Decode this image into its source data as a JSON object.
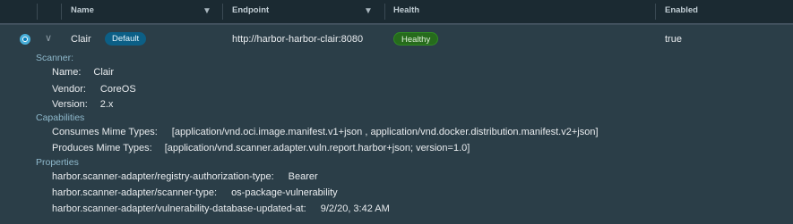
{
  "header": {
    "columns": [
      {
        "label": "Name"
      },
      {
        "label": "Endpoint"
      },
      {
        "label": "Health"
      },
      {
        "label": "Enabled"
      }
    ]
  },
  "row": {
    "name": "Clair",
    "default_badge": "Default",
    "endpoint": "http://harbor-harbor-clair:8080",
    "health": "Healthy",
    "enabled": "true"
  },
  "details": {
    "scanner_heading": "Scanner:",
    "scanner": [
      {
        "label": "Name:",
        "value": "Clair"
      },
      {
        "label": "Vendor:",
        "value": "CoreOS"
      },
      {
        "label": "Version:",
        "value": "2.x"
      }
    ],
    "capabilities_heading": "Capabilities",
    "consumes_label": "Consumes Mime Types:",
    "consumes_value": "[application/vnd.oci.image.manifest.v1+json , application/vnd.docker.distribution.manifest.v2+json]",
    "produces_label": "Produces Mime Types:",
    "produces_value": "[application/vnd.scanner.adapter.vuln.report.harbor+json; version=1.0]",
    "properties_heading": "Properties",
    "properties": [
      {
        "key": "harbor.scanner-adapter/registry-authorization-type:",
        "value": "Bearer"
      },
      {
        "key": "harbor.scanner-adapter/scanner-type:",
        "value": "os-package-vulnerability"
      },
      {
        "key": "harbor.scanner-adapter/vulnerability-database-updated-at:",
        "value": "9/2/20, 3:42 AM"
      }
    ]
  },
  "colors": {
    "accent": "#49afd9",
    "default_badge": "#0c5f86",
    "healthy_badge": "#266b1c"
  },
  "icons": {
    "filter": "filter-icon",
    "expand": "chevron-down-icon",
    "radio": "radio-selected-icon"
  }
}
